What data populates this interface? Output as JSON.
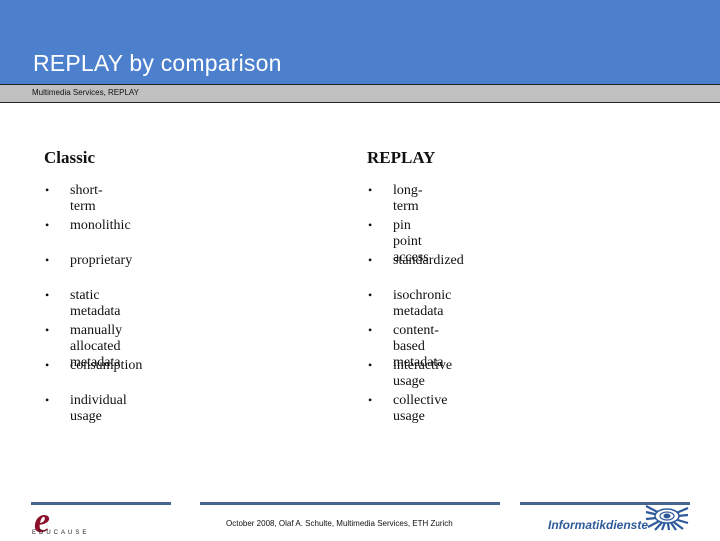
{
  "header": {
    "title": "REPLAY by comparison",
    "subtitle": "Multimedia Services, REPLAY"
  },
  "columns": [
    {
      "heading": "Classic",
      "items": [
        "short-term",
        "monolithic",
        "proprietary",
        "static metadata",
        "manually allocated metadata",
        "consumption",
        "individual usage"
      ]
    },
    {
      "heading": "REPLAY",
      "items": [
        "long-term",
        "pin point access",
        "standardized",
        "isochronic metadata",
        "content-based metadata",
        "interactive usage",
        "collective usage"
      ]
    }
  ],
  "bullet": "•",
  "footer": {
    "text": "October 2008, Olaf A. Schulte, Multimedia Services, ETH Zurich",
    "left_logo_glyph": "e",
    "left_logo_text": "EDUCAUSE",
    "right_logo_text": "Informatikdienste"
  },
  "colors": {
    "header_blue": "#4d80cc",
    "subbar_gray": "#c0c0c0",
    "footer_line": "#46658f"
  }
}
